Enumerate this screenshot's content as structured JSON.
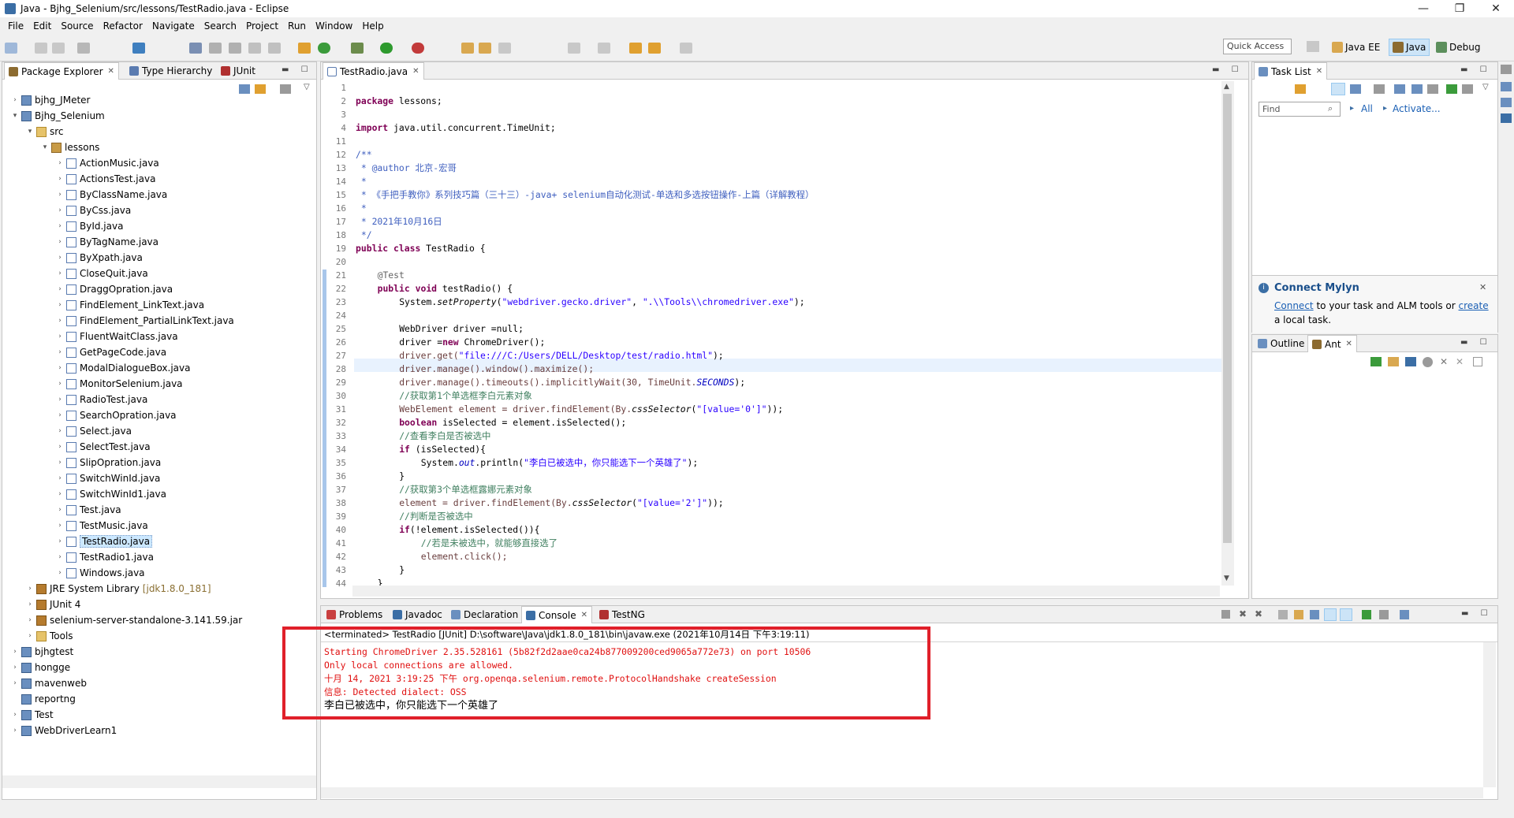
{
  "window": {
    "title": "Java - Bjhg_Selenium/src/lessons/TestRadio.java - Eclipse"
  },
  "menu": [
    "File",
    "Edit",
    "Source",
    "Refactor",
    "Navigate",
    "Search",
    "Project",
    "Run",
    "Window",
    "Help"
  ],
  "toolbar": {
    "quick_access": "Quick Access",
    "perspectives": [
      "Java EE",
      "Java",
      "Debug"
    ]
  },
  "left_panel": {
    "tabs": [
      "Package Explorer",
      "Type Hierarchy",
      "JUnit"
    ],
    "tree": [
      {
        "label": "bjhg_JMeter",
        "type": "proj",
        "depth": 0,
        "expanded": false
      },
      {
        "label": "Bjhg_Selenium",
        "type": "proj",
        "depth": 0,
        "expanded": true
      },
      {
        "label": "src",
        "type": "folder",
        "depth": 1,
        "expanded": true
      },
      {
        "label": "lessons",
        "type": "pkg",
        "depth": 2,
        "expanded": true
      },
      {
        "label": "ActionMusic.java",
        "type": "java",
        "depth": 3
      },
      {
        "label": "ActionsTest.java",
        "type": "java",
        "depth": 3
      },
      {
        "label": "ByClassName.java",
        "type": "java",
        "depth": 3
      },
      {
        "label": "ByCss.java",
        "type": "java",
        "depth": 3
      },
      {
        "label": "ById.java",
        "type": "java",
        "depth": 3
      },
      {
        "label": "ByTagName.java",
        "type": "java",
        "depth": 3
      },
      {
        "label": "ByXpath.java",
        "type": "java",
        "depth": 3
      },
      {
        "label": "CloseQuit.java",
        "type": "java",
        "depth": 3
      },
      {
        "label": "DraggOpration.java",
        "type": "java",
        "depth": 3
      },
      {
        "label": "FindElement_LinkText.java",
        "type": "java",
        "depth": 3
      },
      {
        "label": "FindElement_PartialLinkText.java",
        "type": "java",
        "depth": 3
      },
      {
        "label": "FluentWaitClass.java",
        "type": "java",
        "depth": 3
      },
      {
        "label": "GetPageCode.java",
        "type": "java",
        "depth": 3
      },
      {
        "label": "ModalDialogueBox.java",
        "type": "java",
        "depth": 3
      },
      {
        "label": "MonitorSelenium.java",
        "type": "java",
        "depth": 3
      },
      {
        "label": "RadioTest.java",
        "type": "java",
        "depth": 3
      },
      {
        "label": "SearchOpration.java",
        "type": "java",
        "depth": 3
      },
      {
        "label": "Select.java",
        "type": "java",
        "depth": 3
      },
      {
        "label": "SelectTest.java",
        "type": "java",
        "depth": 3
      },
      {
        "label": "SlipOpration.java",
        "type": "java",
        "depth": 3
      },
      {
        "label": "SwitchWinId.java",
        "type": "java",
        "depth": 3
      },
      {
        "label": "SwitchWinId1.java",
        "type": "java",
        "depth": 3
      },
      {
        "label": "Test.java",
        "type": "java",
        "depth": 3
      },
      {
        "label": "TestMusic.java",
        "type": "java",
        "depth": 3
      },
      {
        "label": "TestRadio.java",
        "type": "java",
        "depth": 3,
        "selected": true
      },
      {
        "label": "TestRadio1.java",
        "type": "java",
        "depth": 3
      },
      {
        "label": "Windows.java",
        "type": "java",
        "depth": 3
      },
      {
        "label": "JRE System Library",
        "suffix": "[jdk1.8.0_181]",
        "type": "lib",
        "depth": 1
      },
      {
        "label": "JUnit 4",
        "type": "lib",
        "depth": 1
      },
      {
        "label": "selenium-server-standalone-3.141.59.jar",
        "type": "lib",
        "depth": 1
      },
      {
        "label": "Tools",
        "type": "folder",
        "depth": 1
      },
      {
        "label": "bjhgtest",
        "type": "proj",
        "depth": 0,
        "expanded": false
      },
      {
        "label": "hongge",
        "type": "proj",
        "depth": 0,
        "expanded": false
      },
      {
        "label": "mavenweb",
        "type": "proj",
        "depth": 0,
        "expanded": false
      },
      {
        "label": "reportng",
        "type": "proj",
        "depth": 0,
        "noarrow": true
      },
      {
        "label": "Test",
        "type": "proj",
        "depth": 0,
        "expanded": false
      },
      {
        "label": "WebDriverLearn1",
        "type": "proj",
        "depth": 0,
        "expanded": false
      }
    ]
  },
  "editor": {
    "tab": "TestRadio.java",
    "line_numbers": [
      "1",
      "2",
      "3",
      "4",
      "11",
      "12",
      "13",
      "14",
      "15",
      "16",
      "17",
      "18",
      "19",
      "20",
      "21",
      "22",
      "23",
      "24",
      "25",
      "26",
      "27",
      "28",
      "29",
      "30",
      "31",
      "32",
      "33",
      "34",
      "35",
      "36",
      "37",
      "38",
      "39",
      "40",
      "41",
      "42",
      "43",
      "44"
    ],
    "lines": {
      "l2": "package lessons;",
      "l4": "import java.util.concurrent.TimeUnit;",
      "l12": "/**",
      "l13": " * @author 北京-宏哥",
      "l14": " *",
      "l15": " * 《手把手教你》系列技巧篇（三十三）-java+ selenium自动化测试-单选和多选按钮操作-上篇（详解教程）",
      "l16": " *",
      "l17": " * 2021年10月16日",
      "l18": " */",
      "l19": "public class TestRadio {",
      "l21": "@Test",
      "l22": "public void testRadio() {",
      "l23a": "System.",
      "l23b": "setProperty",
      "l23c": "(\"webdriver.gecko.driver\", \".\\\\Tools\\\\chromedriver.exe\");",
      "l25": "WebDriver driver =null;",
      "l26": "driver =new ChromeDriver();",
      "l27a": "driver.get(",
      "l27b": "\"file:///C:/Users/DELL/Desktop/test/radio.html\"",
      "l27c": ");",
      "l28": "driver.manage().window().maximize();",
      "l29a": "driver.manage().timeouts().implicitlyWait(30, TimeUnit.",
      "l29b": "SECONDS",
      "l29c": ");",
      "l30": "//获取第1个单选框李白元素对象",
      "l31a": "WebElement element = driver.findElement(By.",
      "l31b": "cssSelector",
      "l31c": "(",
      "l31d": "\"[value='0']\"",
      "l31e": "));",
      "l32": "boolean isSelected = element.isSelected();",
      "l33": "//查看李白是否被选中",
      "l34": "if (isSelected){",
      "l35a": "System.",
      "l35b": "out",
      "l35c": ".println(",
      "l35d": "\"李白已被选中，你只能选下一个英雄了\"",
      "l35e": ");",
      "l36": "}",
      "l37": "//获取第3个单选框露娜元素对象",
      "l38a": "element = driver.findElement(By.",
      "l38b": "cssSelector",
      "l38c": "(",
      "l38d": "\"[value='2']\"",
      "l38e": "));",
      "l39": "//判断是否被选中",
      "l40": "if(!element.isSelected()){",
      "l41": "//若是未被选中，就能够直接选了",
      "l42": "element.click();",
      "l43": "}",
      "l44": "}"
    }
  },
  "right_panel": {
    "task_list_tab": "Task List",
    "find_placeholder": "Find",
    "all_label": "All",
    "activate_label": "Activate...",
    "mylyn_title": "Connect Mylyn",
    "mylyn_link1": "Connect",
    "mylyn_text1": "to your task and ALM tools or",
    "mylyn_link2": "create",
    "mylyn_text2": "a local task.",
    "outline_tab": "Outline",
    "ant_tab": "Ant"
  },
  "bottom_panel": {
    "tabs": [
      "Problems",
      "Javadoc",
      "Declaration",
      "Console",
      "TestNG"
    ],
    "header": "<terminated> TestRadio [JUnit] D:\\software\\Java\\jdk1.8.0_181\\bin\\javaw.exe (2021年10月14日 下午3:19:11)",
    "output": [
      "Starting ChromeDriver 2.35.528161 (5b82f2d2aae0ca24b877009200ced9065a772e73) on port 10506",
      "Only local connections are allowed.",
      "十月 14, 2021 3:19:25 下午 org.openqa.selenium.remote.ProtocolHandshake createSession",
      "信息: Detected dialect: OSS",
      "李白已被选中，你只能选下一个英雄了"
    ],
    "highlight_color": "#e0202a"
  }
}
